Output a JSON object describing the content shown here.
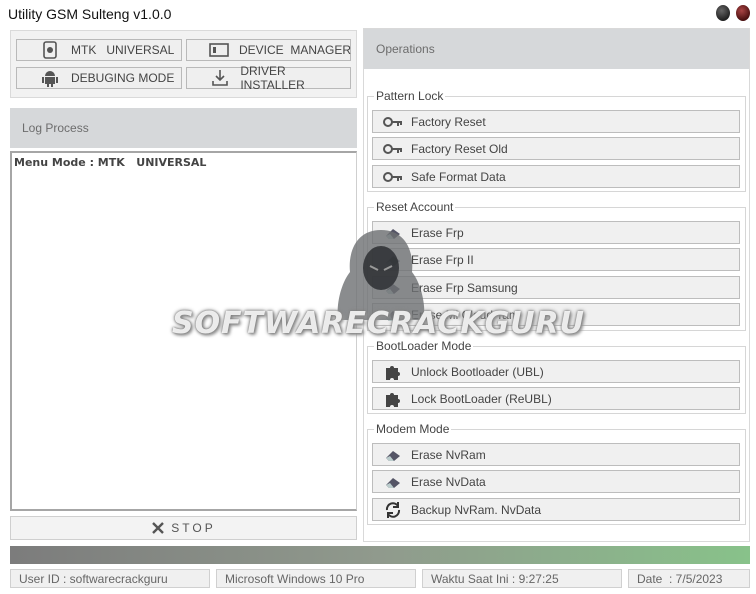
{
  "window": {
    "title": "Utility GSM Sulteng v1.0.0"
  },
  "modes": {
    "mtk": "MTK   UNIVERSAL",
    "device_manager": "DEVICE  MANAGER",
    "debugging": "DEBUGING MODE",
    "driver_installer": "DRIVER INSTALLER"
  },
  "log": {
    "header": "Log Process",
    "text": "Menu Mode : MTK   UNIVERSAL",
    "stop_label": "STOP"
  },
  "operations": {
    "header": "Operations",
    "pattern_lock": {
      "label": "Pattern Lock",
      "buttons": [
        "Factory Reset",
        "Factory Reset Old",
        "Safe Format Data"
      ]
    },
    "reset_account": {
      "label": "Reset Account",
      "buttons": [
        "Erase Frp",
        "Erase Frp II",
        "Erase Frp Samsung",
        "Erase Mi Cloud Tam"
      ]
    },
    "bootloader": {
      "label": "BootLoader Mode",
      "buttons": [
        "Unlock Bootloader (UBL)",
        "Lock BootLoader (ReUBL)"
      ]
    },
    "modem": {
      "label": "Modem Mode",
      "buttons": [
        "Erase NvRam",
        "Erase NvData",
        "Backup NvRam. NvData"
      ]
    }
  },
  "status": {
    "user": "User ID : softwarecrackguru",
    "os": "Microsoft Windows 10 Pro",
    "time": "Waktu Saat Ini : 9:27:25",
    "date": "Date  : 7/5/2023"
  },
  "watermark": "SOFTWARECRACKGURU",
  "colors": {
    "progress_start": "#7c7c7c",
    "progress_end": "#88c28a",
    "header_bg": "#d6d8da"
  }
}
